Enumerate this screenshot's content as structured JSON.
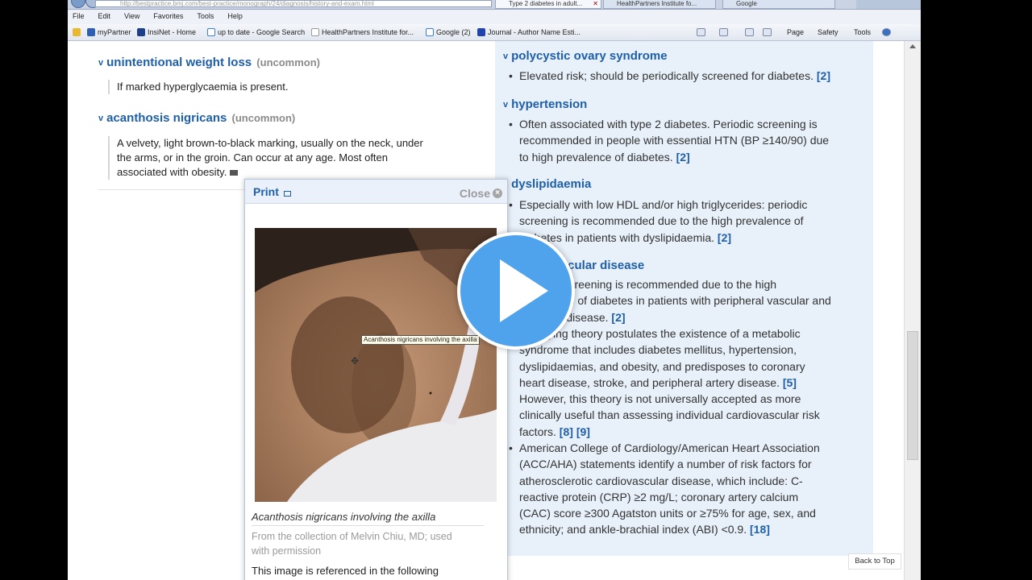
{
  "browser": {
    "address": "http://bestpractice.bmj.com/best-practice/monograph/24/diagnosis/history-and-exam.html",
    "tabs": [
      {
        "label": "Type 2 diabetes in adult...",
        "active": true
      },
      {
        "label": "HealthPartners Institute fo...",
        "active": false
      },
      {
        "label": "Google",
        "active": false
      }
    ],
    "menu": [
      "File",
      "Edit",
      "View",
      "Favorites",
      "Tools",
      "Help"
    ],
    "favorites": [
      "myPartner",
      "InsiNet - Home",
      "up to date - Google Search",
      "HealthPartners Institute for...",
      "Google (2)",
      "Journal - Author Name Esti..."
    ],
    "commands": {
      "page": "Page",
      "safety": "Safety",
      "tools": "Tools"
    }
  },
  "left": {
    "items": [
      {
        "title": "unintentional weight loss",
        "tag": "(uncommon)",
        "text": "If marked hyperglycaemia is present."
      },
      {
        "title": "acanthosis nigricans",
        "tag": "(uncommon)",
        "lines": [
          "A velvety, light brown-to-black marking, usually on the neck, under",
          "the arms, or in the groin. Can occur at any age. Most often",
          "associated with obesity."
        ]
      }
    ]
  },
  "popup": {
    "print": "Print",
    "close": "Close",
    "img_tooltip": "Acanthosis nigricans involving the axilla",
    "caption": "Acanthosis nigricans involving the axilla",
    "credit_lines": [
      "From the collection of Melvin Chiu, MD; used",
      "with permission"
    ],
    "ref_text": "This image is referenced in the following"
  },
  "right": {
    "pcos": {
      "title": "polycystic ovary syndrome",
      "text": "Elevated risk; should be periodically screened for diabetes.",
      "ref": "[2]"
    },
    "htn": {
      "title": "hypertension",
      "lines": [
        "Often associated with type 2 diabetes. Periodic screening is",
        "recommended in people with essential HTN (BP ≥140/90) due",
        "to high prevalence of diabetes."
      ],
      "ref": "[2]"
    },
    "dys": {
      "title": "dyslipidaemia",
      "lines": [
        "Especially with low HDL and/or high triglycerides: periodic",
        "screening is recommended due to the high prevalence of",
        "diabetes in patients with dyslipidaemia."
      ],
      "ref": "[2]"
    },
    "cvd": {
      "title": "cardiovascular disease",
      "b1_lines": [
        "Periodic screening is recommended due to the high",
        "prevalence of diabetes in patients with peripheral vascular and",
        "coronary disease."
      ],
      "b1_ref": "[2]",
      "b2_lines": [
        "A unifying theory postulates the existence of a metabolic",
        "syndrome that includes diabetes mellitus, hypertension,",
        "dyslipidaemias, and obesity, and predisposes to coronary",
        "heart disease, stroke, and peripheral artery disease.",
        "However, this theory is not universally accepted as more",
        "clinically useful than assessing individual cardiovascular risk",
        "factors."
      ],
      "b2_ref1": "[5]",
      "b2_ref2": "[8]",
      "b2_ref3": "[9]",
      "b3_lines": [
        "American College of Cardiology/American Heart Association",
        "(ACC/AHA) statements identify a number of risk factors for",
        "atherosclerotic cardiovascular disease, which include: C-",
        "reactive protein (CRP) ≥2 mg/L; coronary artery calcium",
        "(CAC) score ≥300 Agatston units or ≥75% for age, sex, and",
        "ethnicity; and ankle-brachial index (ABI) <0.9."
      ],
      "b3_ref": "[18]"
    }
  },
  "back_to_top": "Back to Top",
  "colors": {
    "link": "#1e5fa8",
    "panel": "#e8f0fa",
    "play": "#4fa3ec"
  }
}
